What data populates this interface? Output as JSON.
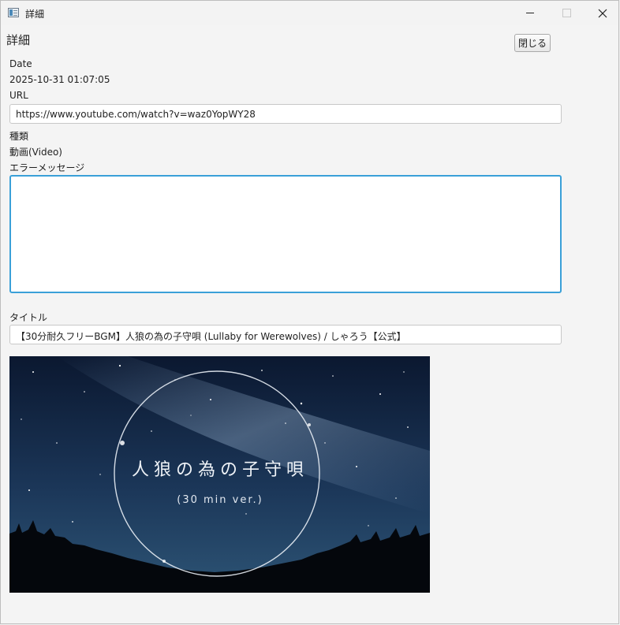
{
  "window": {
    "title": "詳細",
    "icon": "app-window-icon"
  },
  "header": {
    "title": "詳細",
    "close_button": "閉じる"
  },
  "fields": {
    "date_label": "Date",
    "date_value": "2025-10-31 01:07:05",
    "url_label": "URL",
    "url_value": "https://www.youtube.com/watch?v=waz0YopWY28",
    "type_label": "種類",
    "type_value": "動画(Video)",
    "error_label": "エラーメッセージ",
    "error_value": "",
    "title_label": "タイトル",
    "title_value": "【30分耐久フリーBGM】人狼の為の子守唄 (Lullaby for Werewolves) / しゃろう【公式】"
  },
  "thumbnail": {
    "title": "人狼の為の子守唄",
    "subtitle": "(30 min ver.)"
  },
  "colors": {
    "focus_border": "#3aa0d8",
    "sky_top": "#0b1830",
    "sky_bottom": "#26486a"
  }
}
